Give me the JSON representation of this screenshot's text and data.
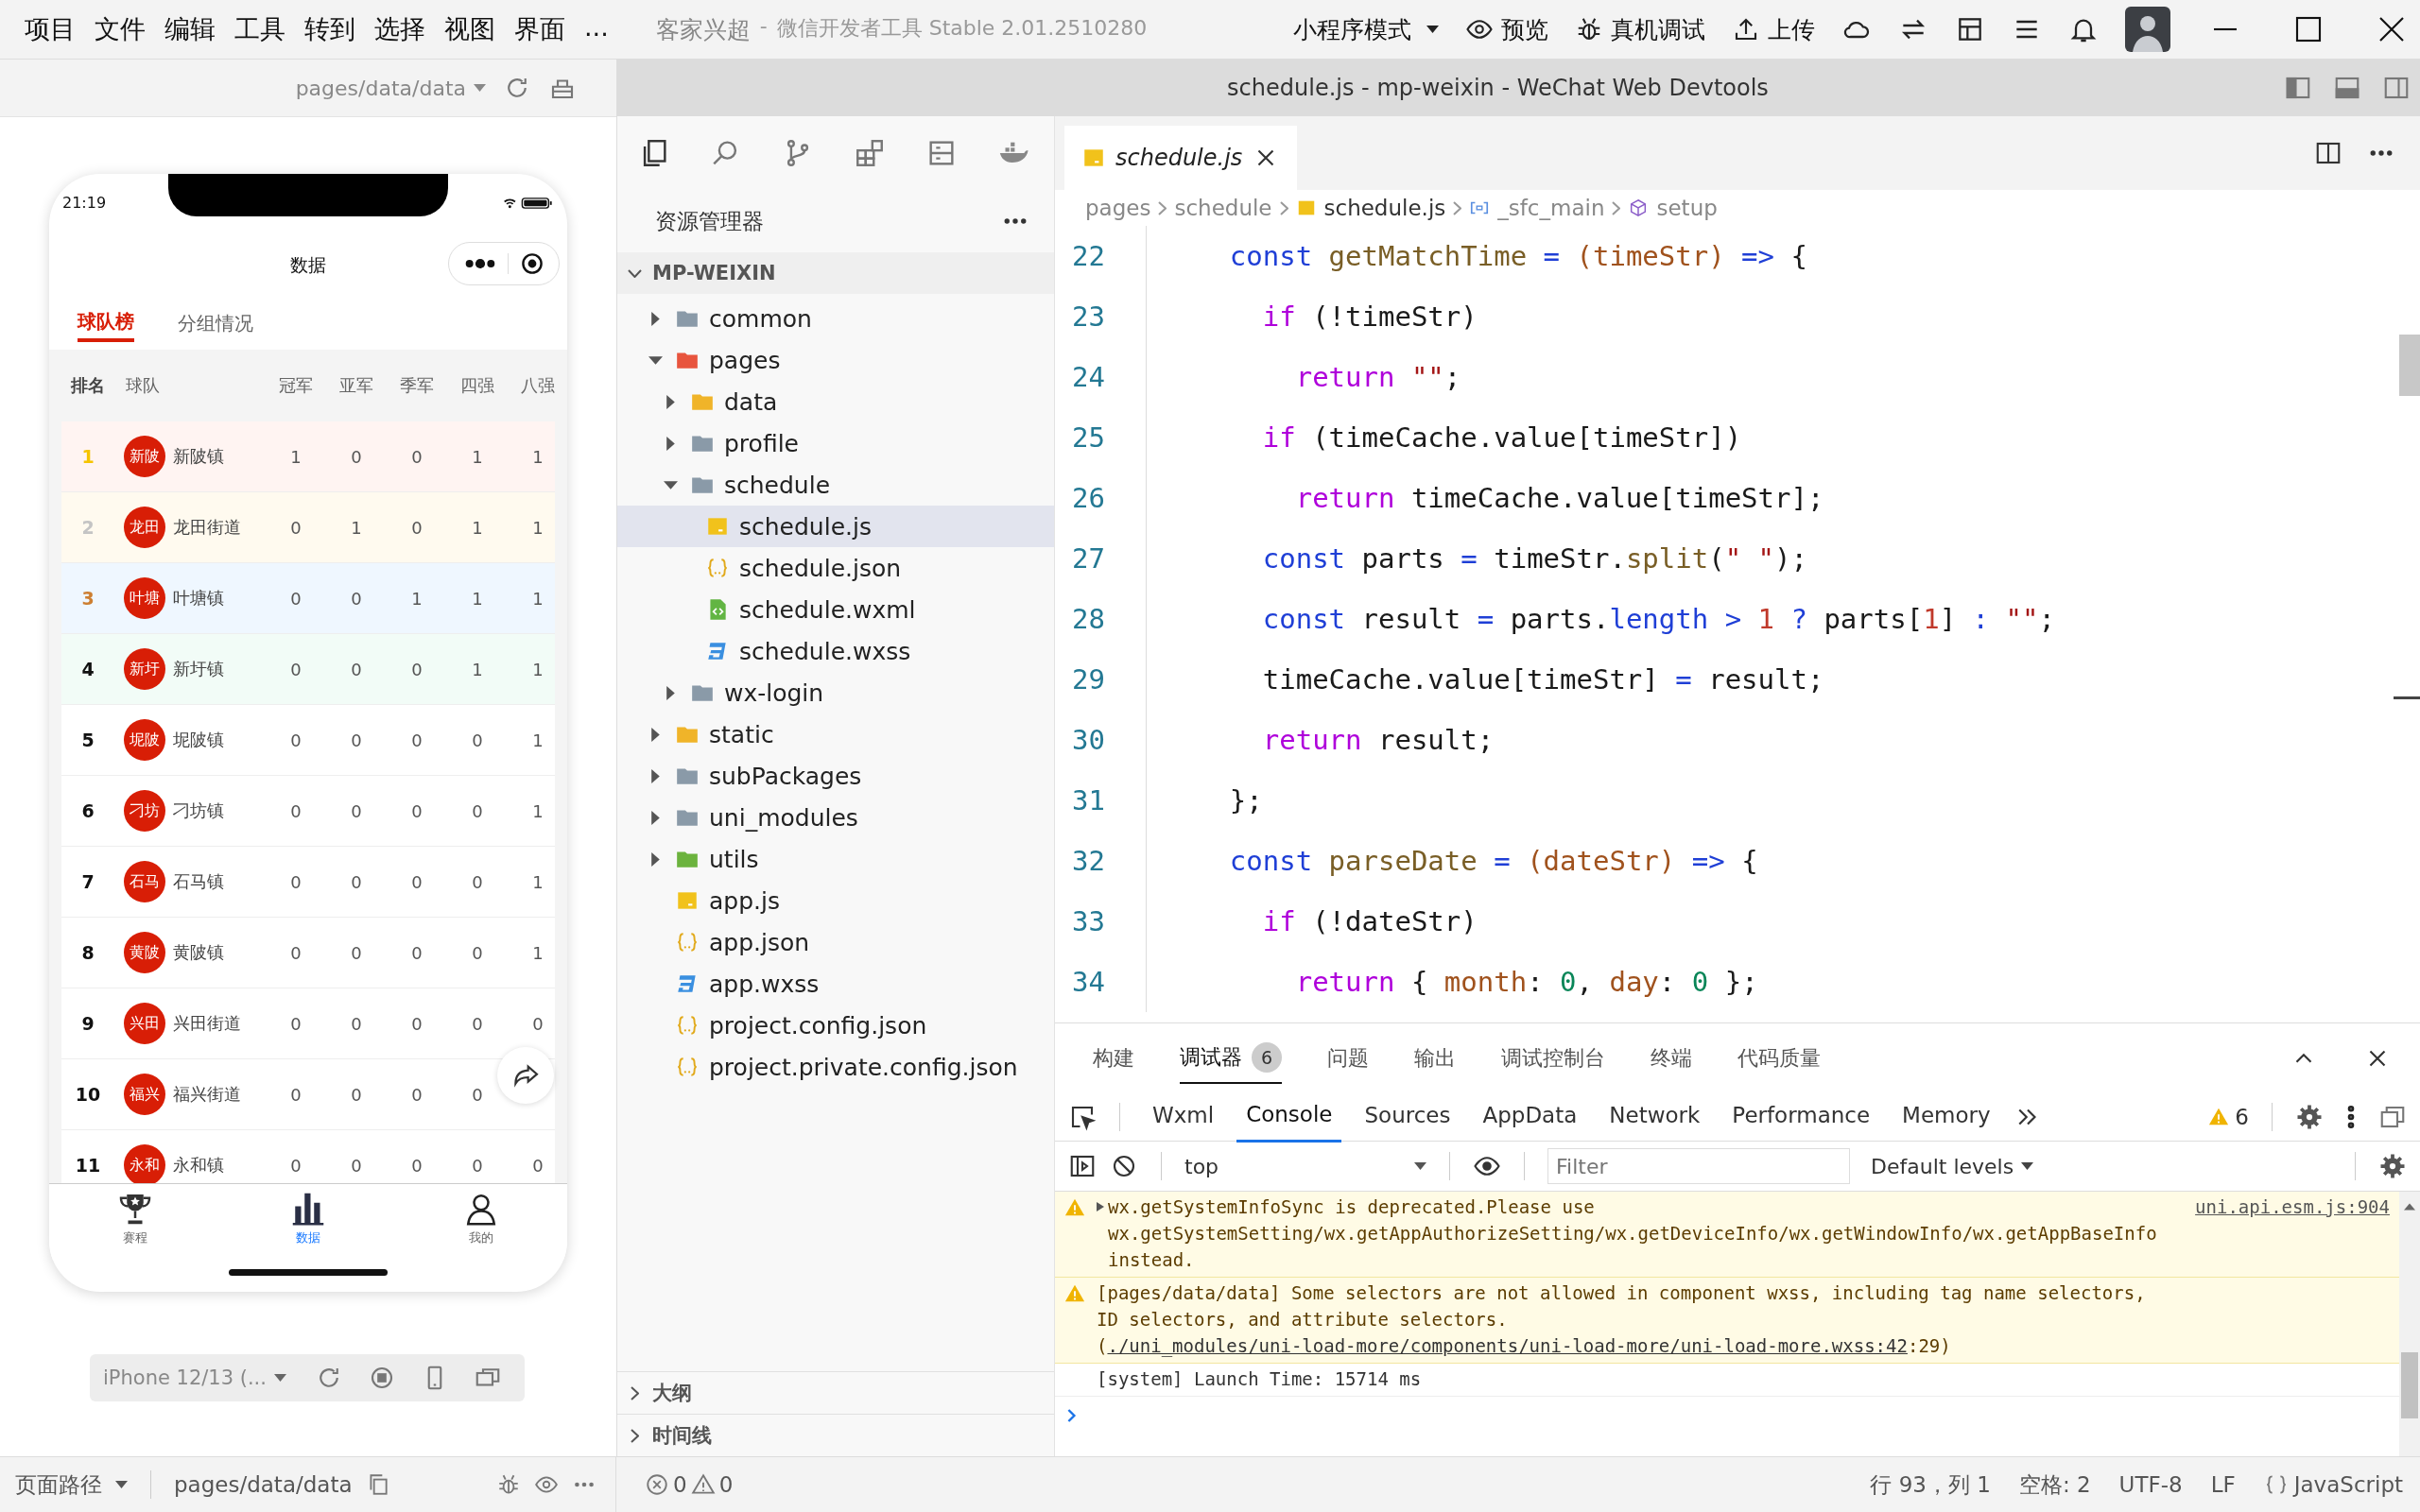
{
  "menu_bar": {
    "items": [
      "项目",
      "文件",
      "编辑",
      "工具",
      "转到",
      "选择",
      "视图",
      "界面",
      "..."
    ]
  },
  "app_title": {
    "project": "客家兴超",
    "separator": "-",
    "product": "微信开发者工具 Stable 2.01.2510280"
  },
  "toolbar": {
    "mode": "小程序模式",
    "actions": [
      {
        "label": "预览",
        "kind": "eye"
      },
      {
        "label": "真机调试",
        "kind": "bug"
      },
      {
        "label": "上传",
        "kind": "upload"
      }
    ]
  },
  "simulator": {
    "path": "pages/data/data",
    "device": "iPhone 12/13 (...",
    "phone": {
      "time": "21:19",
      "nav_title": "数据",
      "tabs": [
        {
          "label": "球队榜",
          "selected": true
        },
        {
          "label": "分组情况",
          "selected": false
        }
      ],
      "columns": [
        "排名",
        "球队",
        "冠军",
        "亚军",
        "季军",
        "四强",
        "八强"
      ],
      "rows": [
        {
          "rank": "1",
          "badge": "新陂",
          "team": "新陂镇",
          "values": [
            "1",
            "0",
            "0",
            "1",
            "1"
          ],
          "kind": "gold"
        },
        {
          "rank": "2",
          "badge": "龙田",
          "team": "龙田街道",
          "values": [
            "0",
            "1",
            "0",
            "1",
            "1"
          ],
          "kind": "silver"
        },
        {
          "rank": "3",
          "badge": "叶塘",
          "team": "叶塘镇",
          "values": [
            "0",
            "0",
            "1",
            "1",
            "1"
          ],
          "kind": "bronze"
        },
        {
          "rank": "4",
          "badge": "新圩",
          "team": "新圩镇",
          "values": [
            "0",
            "0",
            "0",
            "1",
            "1"
          ],
          "kind": "top"
        },
        {
          "rank": "5",
          "badge": "坭陂",
          "team": "坭陂镇",
          "values": [
            "0",
            "0",
            "0",
            "0",
            "1"
          ],
          "kind": "plain"
        },
        {
          "rank": "6",
          "badge": "刁坊",
          "team": "刁坊镇",
          "values": [
            "0",
            "0",
            "0",
            "0",
            "1"
          ],
          "kind": "plain"
        },
        {
          "rank": "7",
          "badge": "石马",
          "team": "石马镇",
          "values": [
            "0",
            "0",
            "0",
            "0",
            "1"
          ],
          "kind": "plain"
        },
        {
          "rank": "8",
          "badge": "黄陂",
          "team": "黄陂镇",
          "values": [
            "0",
            "0",
            "0",
            "0",
            "1"
          ],
          "kind": "plain"
        },
        {
          "rank": "9",
          "badge": "兴田",
          "team": "兴田街道",
          "values": [
            "0",
            "0",
            "0",
            "0",
            "0"
          ],
          "kind": "plain"
        },
        {
          "rank": "10",
          "badge": "福兴",
          "team": "福兴街道",
          "values": [
            "0",
            "0",
            "0",
            "0"
          ],
          "kind": "plain"
        },
        {
          "rank": "11",
          "badge": "永和",
          "team": "永和镇",
          "values": [
            "0",
            "0",
            "0",
            "0",
            "0"
          ],
          "kind": "plain"
        }
      ],
      "tab_bar": [
        {
          "label": "赛程",
          "kind": "trophy",
          "selected": false
        },
        {
          "label": "数据",
          "kind": "chart",
          "selected": true
        },
        {
          "label": "我的",
          "kind": "person",
          "selected": false
        }
      ]
    }
  },
  "window_title": "schedule.js - mp-weixin - WeChat Web Devtools",
  "explorer": {
    "title": "资源管理器",
    "root": {
      "label": "MP-WEIXIN",
      "expanded": true
    },
    "tree": [
      {
        "label": "common",
        "kind": "folder",
        "color": "#8a9aa8",
        "expanded": false,
        "selected": false
      },
      {
        "label": "pages",
        "kind": "folder",
        "color": "#e8553e",
        "expanded": true,
        "selected": false,
        "children": [
          {
            "label": "data",
            "kind": "folder",
            "color": "#f0b429",
            "expanded": false,
            "selected": false
          },
          {
            "label": "profile",
            "kind": "folder",
            "color": "#8a9aa8",
            "expanded": false,
            "selected": false
          },
          {
            "label": "schedule",
            "kind": "folder",
            "color": "#8a9aa8",
            "expanded": true,
            "selected": false,
            "children": [
              {
                "label": "schedule.js",
                "kind": "js",
                "selected": true
              },
              {
                "label": "schedule.json",
                "kind": "json",
                "selected": false
              },
              {
                "label": "schedule.wxml",
                "kind": "wxml",
                "selected": false
              },
              {
                "label": "schedule.wxss",
                "kind": "wxss",
                "selected": false
              }
            ]
          },
          {
            "label": "wx-login",
            "kind": "folder",
            "color": "#8a9aa8",
            "expanded": false,
            "selected": false
          }
        ]
      },
      {
        "label": "static",
        "kind": "folder",
        "color": "#f0b429",
        "expanded": false,
        "selected": false
      },
      {
        "label": "subPackages",
        "kind": "folder",
        "color": "#8a9aa8",
        "expanded": false,
        "selected": false
      },
      {
        "label": "uni_modules",
        "kind": "folder",
        "color": "#8a9aa8",
        "expanded": false,
        "selected": false
      },
      {
        "label": "utils",
        "kind": "folder",
        "color": "#6cb33e",
        "expanded": false,
        "selected": false
      },
      {
        "label": "app.js",
        "kind": "js",
        "selected": false
      },
      {
        "label": "app.json",
        "kind": "json",
        "selected": false
      },
      {
        "label": "app.wxss",
        "kind": "wxss",
        "selected": false
      },
      {
        "label": "project.config.json",
        "kind": "json",
        "selected": false
      },
      {
        "label": "project.private.config.json",
        "kind": "json",
        "selected": false
      }
    ],
    "sections": [
      {
        "label": "大纲",
        "expanded": false
      },
      {
        "label": "时间线",
        "expanded": false
      }
    ]
  },
  "editor": {
    "tab": {
      "label": "schedule.js",
      "kind": "js"
    },
    "breadcrumb": [
      {
        "label": "pages",
        "kind": "text"
      },
      {
        "label": "schedule",
        "kind": "text"
      },
      {
        "label": "schedule.js",
        "kind": "js"
      },
      {
        "label": "_sfc_main",
        "kind": "module"
      },
      {
        "label": "setup",
        "kind": "method"
      }
    ],
    "lines": [
      {
        "num": "22",
        "tokens": [
          {
            "kind": "kw",
            "text": "    const"
          },
          {
            "kind": "fn",
            "text": " getMatchTime"
          },
          {
            "kind": "op",
            "text": " ="
          },
          {
            "kind": "param",
            "text": " (timeStr)"
          },
          {
            "kind": "op",
            "text": " =>"
          },
          {
            "kind": "p",
            "text": " {"
          }
        ]
      },
      {
        "num": "23",
        "tokens": [
          {
            "kind": "ctl",
            "text": "      if"
          },
          {
            "kind": "p",
            "text": " (!timeStr)"
          }
        ]
      },
      {
        "num": "24",
        "tokens": [
          {
            "kind": "ctl",
            "text": "        return"
          },
          {
            "kind": "str",
            "text": " \"\""
          },
          {
            "kind": "p",
            "text": ";"
          }
        ]
      },
      {
        "num": "25",
        "tokens": [
          {
            "kind": "ctl",
            "text": "      if"
          },
          {
            "kind": "p",
            "text": " (timeCache.value[timeStr])"
          }
        ]
      },
      {
        "num": "26",
        "tokens": [
          {
            "kind": "ctl",
            "text": "        return"
          },
          {
            "kind": "p",
            "text": " timeCache.value[timeStr];"
          }
        ]
      },
      {
        "num": "27",
        "tokens": [
          {
            "kind": "kw",
            "text": "      const"
          },
          {
            "kind": "p",
            "text": " parts"
          },
          {
            "kind": "op",
            "text": " ="
          },
          {
            "kind": "p",
            "text": " timeStr."
          },
          {
            "kind": "fn",
            "text": "split"
          },
          {
            "kind": "p",
            "text": "("
          },
          {
            "kind": "str",
            "text": "\" \""
          },
          {
            "kind": "p",
            "text": ");"
          }
        ]
      },
      {
        "num": "28",
        "tokens": [
          {
            "kind": "kw",
            "text": "      const"
          },
          {
            "kind": "p",
            "text": " result"
          },
          {
            "kind": "op",
            "text": " ="
          },
          {
            "kind": "p",
            "text": " parts."
          },
          {
            "kind": "prop",
            "text": "length"
          },
          {
            "kind": "op",
            "text": " >"
          },
          {
            "kind": "num",
            "text": " 1"
          },
          {
            "kind": "op",
            "text": " ?"
          },
          {
            "kind": "p",
            "text": " parts["
          },
          {
            "kind": "num",
            "text": "1"
          },
          {
            "kind": "p",
            "text": "]"
          },
          {
            "kind": "op",
            "text": " :"
          },
          {
            "kind": "str",
            "text": " \"\""
          },
          {
            "kind": "p",
            "text": ";"
          }
        ]
      },
      {
        "num": "29",
        "tokens": [
          {
            "kind": "p",
            "text": "      timeCache.value[timeStr]"
          },
          {
            "kind": "op",
            "text": " ="
          },
          {
            "kind": "p",
            "text": " result;"
          }
        ]
      },
      {
        "num": "30",
        "tokens": [
          {
            "kind": "ctl",
            "text": "      return"
          },
          {
            "kind": "p",
            "text": " result;"
          }
        ]
      },
      {
        "num": "31",
        "tokens": [
          {
            "kind": "p",
            "text": "    };"
          }
        ]
      },
      {
        "num": "32",
        "tokens": [
          {
            "kind": "kw",
            "text": "    const"
          },
          {
            "kind": "fn",
            "text": " parseDate"
          },
          {
            "kind": "op",
            "text": " ="
          },
          {
            "kind": "param",
            "text": " (dateStr)"
          },
          {
            "kind": "op",
            "text": " =>"
          },
          {
            "kind": "p",
            "text": " {"
          }
        ]
      },
      {
        "num": "33",
        "tokens": [
          {
            "kind": "ctl",
            "text": "      if"
          },
          {
            "kind": "p",
            "text": " (!dateStr)"
          }
        ]
      },
      {
        "num": "34",
        "tokens": [
          {
            "kind": "ctl",
            "text": "        return"
          },
          {
            "kind": "p",
            "text": " {"
          },
          {
            "kind": "param",
            "text": " month"
          },
          {
            "kind": "p",
            "text": ":"
          },
          {
            "kind": "num0",
            "text": " 0"
          },
          {
            "kind": "p",
            "text": ","
          },
          {
            "kind": "param",
            "text": " day"
          },
          {
            "kind": "p",
            "text": ":"
          },
          {
            "kind": "num0",
            "text": " 0"
          },
          {
            "kind": "p",
            "text": " };"
          }
        ]
      }
    ]
  },
  "devtools": {
    "panel_tabs": [
      {
        "label": "构建",
        "selected": false
      },
      {
        "label": "调试器",
        "selected": true,
        "badge": "6"
      },
      {
        "label": "问题",
        "selected": false
      },
      {
        "label": "输出",
        "selected": false
      },
      {
        "label": "调试控制台",
        "selected": false
      },
      {
        "label": "终端",
        "selected": false
      },
      {
        "label": "代码质量",
        "selected": false
      }
    ],
    "tool_tabs": [
      {
        "label": "Wxml",
        "selected": false
      },
      {
        "label": "Console",
        "selected": true
      },
      {
        "label": "Sources",
        "selected": false
      },
      {
        "label": "AppData",
        "selected": false
      },
      {
        "label": "Network",
        "selected": false
      },
      {
        "label": "Performance",
        "selected": false
      },
      {
        "label": "Memory",
        "selected": false
      }
    ],
    "warning_count": "6",
    "console_toolbar": {
      "context": "top",
      "filter_placeholder": "Filter",
      "levels": "Default levels"
    },
    "messages": [
      {
        "kind": "warning",
        "expandable": true,
        "text": "wx.getSystemInfoSync is deprecated.Please use wx.getSystemSetting/wx.getAppAuthorizeSetting/wx.getDeviceInfo/wx.getWindowInfo/wx.getAppBaseInfo instead.",
        "source": "uni.api.esm.js:904"
      },
      {
        "kind": "warning",
        "text": "[pages/data/data] Some selectors are not allowed in component wxss, including tag name selectors, ID selectors, and attribute selectors.(",
        "link": "./uni_modules/uni-load-more/components/uni-load-more/uni-load-more.wxss:42",
        "after": ":29)"
      },
      {
        "kind": "info",
        "text": "[system] Launch Time: 15714 ms"
      }
    ]
  },
  "status_bar": {
    "path_label": "页面路径",
    "path": "pages/data/data",
    "errors": "0",
    "warnings": "0",
    "position": "行 93，列 1",
    "spaces": "空格: 2",
    "encoding": "UTF-8",
    "eol": "LF",
    "language": "JavaScript"
  }
}
